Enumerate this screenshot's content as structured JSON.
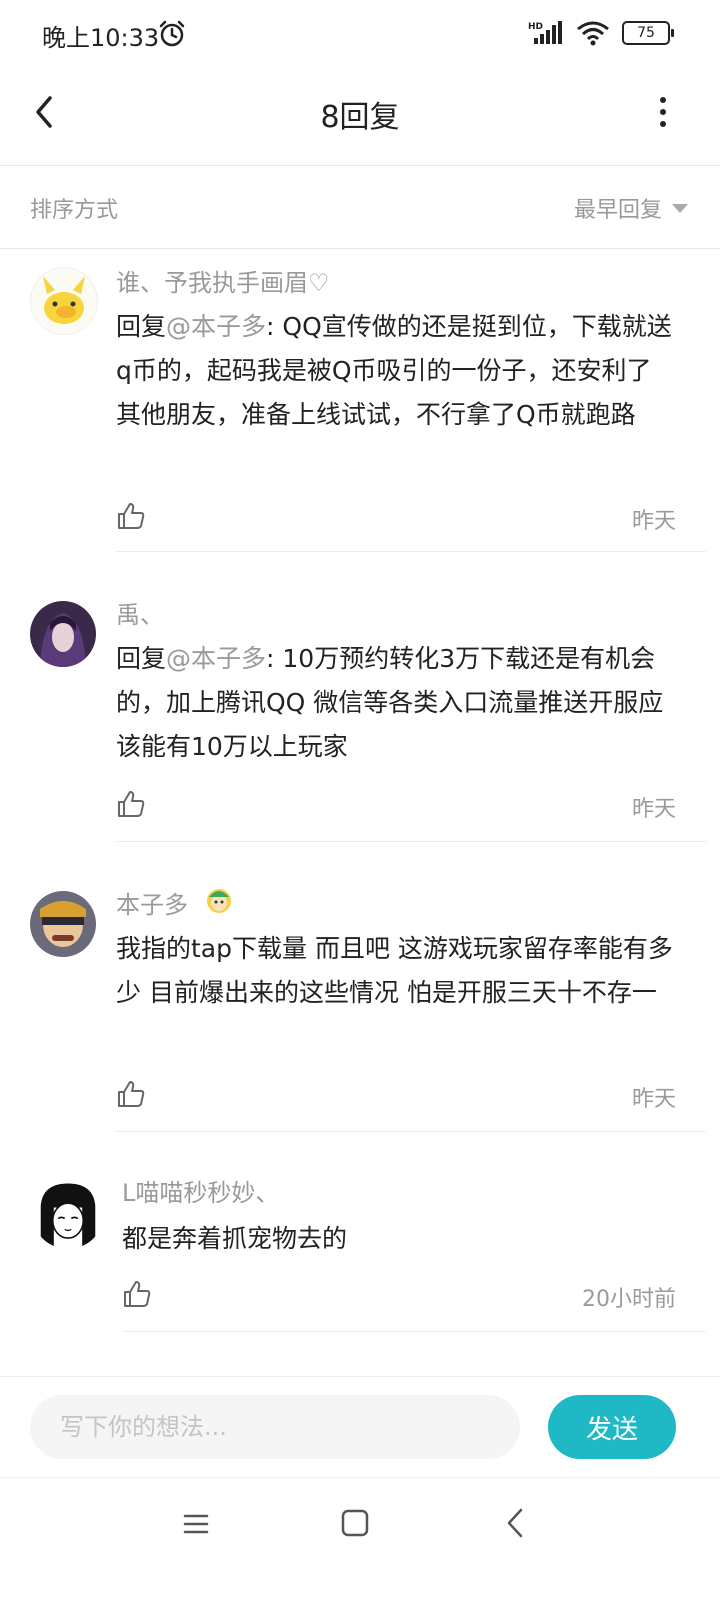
{
  "status_bar": {
    "time": "晚上10:33",
    "battery": "75",
    "network": "HD"
  },
  "header": {
    "title": "8回复"
  },
  "sort": {
    "label": "排序方式",
    "value": "最早回复"
  },
  "comments": [
    {
      "name": "谁、予我执手画眉♡",
      "reply_prefix": "回复",
      "mention": "@本子多",
      "text": ": QQ宣传做的还是挺到位，下载就送q币的，起码我是被Q币吸引的一份子，还安利了其他朋友，准备上线试试，不行拿了Q币就跑路",
      "time": "昨天"
    },
    {
      "name": "禹、",
      "reply_prefix": "回复",
      "mention": "@本子多",
      "text": ": 10万预约转化3万下载还是有机会的，加上腾讯QQ 微信等各类入口流量推送开服应该能有10万以上玩家",
      "time": "昨天"
    },
    {
      "name": "本子多",
      "text": "我指的tap下载量  而且吧  这游戏玩家留存率能有多少 目前爆出来的这些情况  怕是开服三天十不存一",
      "time": "昨天"
    },
    {
      "name": "L喵喵秒秒妙、",
      "text": "都是奔着抓宠物去的",
      "time": "20小时前"
    }
  ],
  "composer": {
    "placeholder": "写下你的想法...",
    "send_label": "发送"
  },
  "colors": {
    "accent": "#1fb8c5",
    "muted": "#9a9a9a"
  }
}
